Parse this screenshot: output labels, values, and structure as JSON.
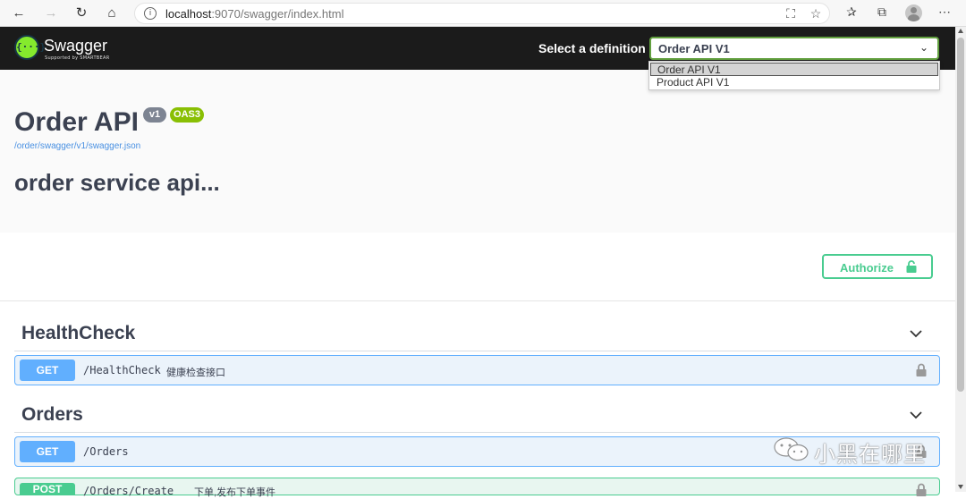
{
  "browser": {
    "url_host": "localhost",
    "url_path": ":9070/swagger/index.html",
    "icons": [
      "back-icon",
      "forward-icon",
      "refresh-icon",
      "home-icon",
      "info-icon",
      "translate-icon",
      "star-icon",
      "favorites-icon",
      "collections-icon",
      "profile-icon",
      "more-icon"
    ]
  },
  "topbar": {
    "logo_text": "Swagger",
    "logo_glyph": "{···}",
    "logo_sub": "Supported by SMARTBEAR",
    "definition_label": "Select a definition",
    "selected_definition": "Order API V1",
    "definition_options": [
      "Order API V1",
      "Product API V1"
    ],
    "accent_color": "#85ea2d"
  },
  "info": {
    "title": "Order API",
    "version_badge": "v1",
    "oas_badge": "OAS3",
    "spec_link": "/order/swagger/v1/swagger.json",
    "description": "order service api..."
  },
  "auth": {
    "label": "Authorize"
  },
  "sections": [
    {
      "name": "HealthCheck",
      "operations": [
        {
          "method": "GET",
          "path": "/HealthCheck",
          "summary": "健康检查接口"
        }
      ]
    },
    {
      "name": "Orders",
      "operations": [
        {
          "method": "GET",
          "path": "/Orders",
          "summary": ""
        },
        {
          "method": "POST",
          "path": "/Orders/Create",
          "summary": "下单,发布下单事件"
        }
      ]
    }
  ],
  "colors": {
    "get": "#61affe",
    "post": "#49cc90",
    "title": "#3b4151"
  },
  "watermark": {
    "text": "小黑在哪里"
  }
}
